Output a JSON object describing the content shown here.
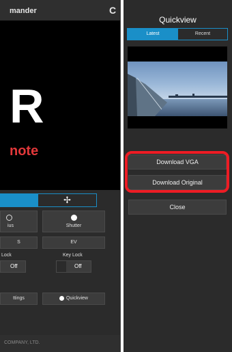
{
  "left": {
    "header_title": "mander",
    "refresh_glyph": "C",
    "preview_letter": "R",
    "preview_word": "note",
    "tab_move_glyph": "✢",
    "focus_label": "ius",
    "shutter_label": "Shutter",
    "iso_label": "S",
    "ev_label": "EV",
    "lock_left_label": "Lock",
    "lock_left_value": "Off",
    "key_lock_label": "Key Lock",
    "key_lock_value": "Off",
    "settings_label": "ttings",
    "quickview_label": "Quickview",
    "footer_text": "COMPANY, LTD."
  },
  "right": {
    "title": "Quickview",
    "tab_latest": "Latest",
    "tab_recent": "Recent",
    "download_vga": "Download VGA",
    "download_original": "Download Original",
    "close": "Close"
  },
  "colors": {
    "accent": "#1a8fc8",
    "highlight": "#ee1c24",
    "panel": "#2b2b2b"
  },
  "icons": [
    "refresh-icon",
    "move-icon",
    "focus-icon",
    "shutter-icon",
    "quickview-icon"
  ]
}
